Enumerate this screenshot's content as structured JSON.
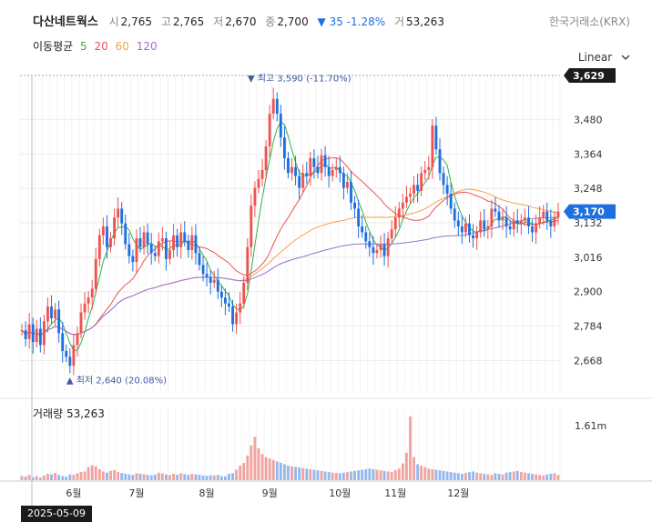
{
  "header": {
    "name": "다산네트웍스",
    "open_label": "시",
    "open": "2,765",
    "high_label": "고",
    "high": "2,765",
    "low_label": "저",
    "low": "2,670",
    "close_label": "종",
    "close": "2,700",
    "change": "▼ 35 -1.28%",
    "volume_label": "거",
    "volume": "53,263",
    "exchange": "한국거래소(KRX)"
  },
  "ma_legend": {
    "label": "이동평균",
    "items": [
      {
        "label": "5",
        "color": "#2db34a"
      },
      {
        "label": "20",
        "color": "#ef5350"
      },
      {
        "label": "60",
        "color": "#f5a04a"
      },
      {
        "label": "120",
        "color": "#9a6fd6"
      }
    ]
  },
  "scale_button": "Linear",
  "volume_panel": {
    "label": "거래량",
    "value": "53,263",
    "axis_label": "1.61m"
  },
  "cursor_date": "2025-05-09",
  "annotations": {
    "max": "▼ 최고 3,590 (-11.70%)",
    "min": "▲ 최저 2,640 (20.08%)"
  },
  "chart_data": {
    "type": "candlestick",
    "y_ticks": [
      2668,
      2784,
      2900,
      3016,
      3132,
      3248,
      3364,
      3480
    ],
    "y_tick_labels": [
      "2,668",
      "2,784",
      "2,900",
      "3,016",
      "3,132",
      "3,248",
      "3,364",
      "3,480"
    ],
    "ylim": [
      2620,
      3629
    ],
    "price_tags": [
      {
        "label": "3,629",
        "value": 3629,
        "color": "#1b1b1b"
      },
      {
        "label": "3,170",
        "value": 3170,
        "color": "#1e6fe0"
      }
    ],
    "x_labels": [
      "6월",
      "7월",
      "8월",
      "9월",
      "10월",
      "11월",
      "12월"
    ],
    "x_label_index": [
      14,
      31,
      50,
      67,
      86,
      101,
      118
    ],
    "max_point": {
      "index": 62,
      "value": 3590
    },
    "min_point": {
      "index": 13,
      "value": 2640
    },
    "colors": {
      "up": "#ef5350",
      "down": "#1e6fe0"
    },
    "closes": [
      2770,
      2740,
      2790,
      2730,
      2775,
      2720,
      2800,
      2850,
      2810,
      2840,
      2760,
      2700,
      2680,
      2650,
      2720,
      2760,
      2830,
      2860,
      2880,
      2910,
      3010,
      3090,
      3120,
      3050,
      3080,
      3150,
      3180,
      3130,
      3060,
      3020,
      3000,
      3080,
      3050,
      3100,
      3060,
      3030,
      3020,
      3070,
      3080,
      3010,
      3040,
      3090,
      3050,
      3100,
      3070,
      3040,
      3090,
      3030,
      2990,
      2960,
      2950,
      2930,
      2940,
      2900,
      2880,
      2860,
      2850,
      2790,
      2830,
      2860,
      2930,
      3050,
      3190,
      3250,
      3280,
      3310,
      3390,
      3500,
      3550,
      3500,
      3420,
      3350,
      3300,
      3320,
      3290,
      3250,
      3300,
      3290,
      3350,
      3320,
      3300,
      3360,
      3320,
      3290,
      3310,
      3320,
      3300,
      3250,
      3270,
      3200,
      3180,
      3120,
      3100,
      3070,
      3050,
      3030,
      3040,
      3060,
      3020,
      3080,
      3110,
      3150,
      3180,
      3200,
      3220,
      3230,
      3260,
      3240,
      3300,
      3310,
      3320,
      3460,
      3380,
      3300,
      3260,
      3230,
      3180,
      3140,
      3120,
      3100,
      3130,
      3090,
      3080,
      3100,
      3140,
      3110,
      3120,
      3180,
      3170,
      3140,
      3150,
      3120,
      3110,
      3140,
      3130,
      3140,
      3150,
      3120,
      3100,
      3130,
      3150,
      3170,
      3140,
      3120,
      3150,
      3170
    ],
    "volumes": [
      15,
      12,
      18,
      10,
      14,
      9,
      16,
      22,
      20,
      25,
      18,
      14,
      12,
      20,
      19,
      24,
      28,
      30,
      45,
      52,
      48,
      38,
      30,
      26,
      32,
      35,
      28,
      25,
      22,
      20,
      18,
      24,
      22,
      21,
      18,
      17,
      19,
      26,
      23,
      20,
      18,
      22,
      19,
      24,
      21,
      18,
      22,
      20,
      18,
      16,
      15,
      17,
      16,
      18,
      14,
      13,
      22,
      24,
      36,
      50,
      60,
      85,
      120,
      150,
      110,
      90,
      80,
      75,
      70,
      65,
      60,
      55,
      50,
      48,
      46,
      44,
      42,
      40,
      38,
      36,
      34,
      32,
      30,
      28,
      26,
      25,
      24,
      26,
      28,
      30,
      32,
      34,
      36,
      38,
      40,
      38,
      36,
      34,
      32,
      30,
      28,
      35,
      40,
      58,
      95,
      220,
      80,
      55,
      50,
      45,
      40,
      38,
      36,
      34,
      32,
      30,
      28,
      26,
      24,
      22,
      25,
      28,
      30,
      26,
      24,
      22,
      20,
      18,
      24,
      22,
      20,
      26,
      28,
      30,
      32,
      28,
      26,
      24,
      22,
      20,
      18,
      16,
      20,
      22,
      24,
      18
    ]
  }
}
